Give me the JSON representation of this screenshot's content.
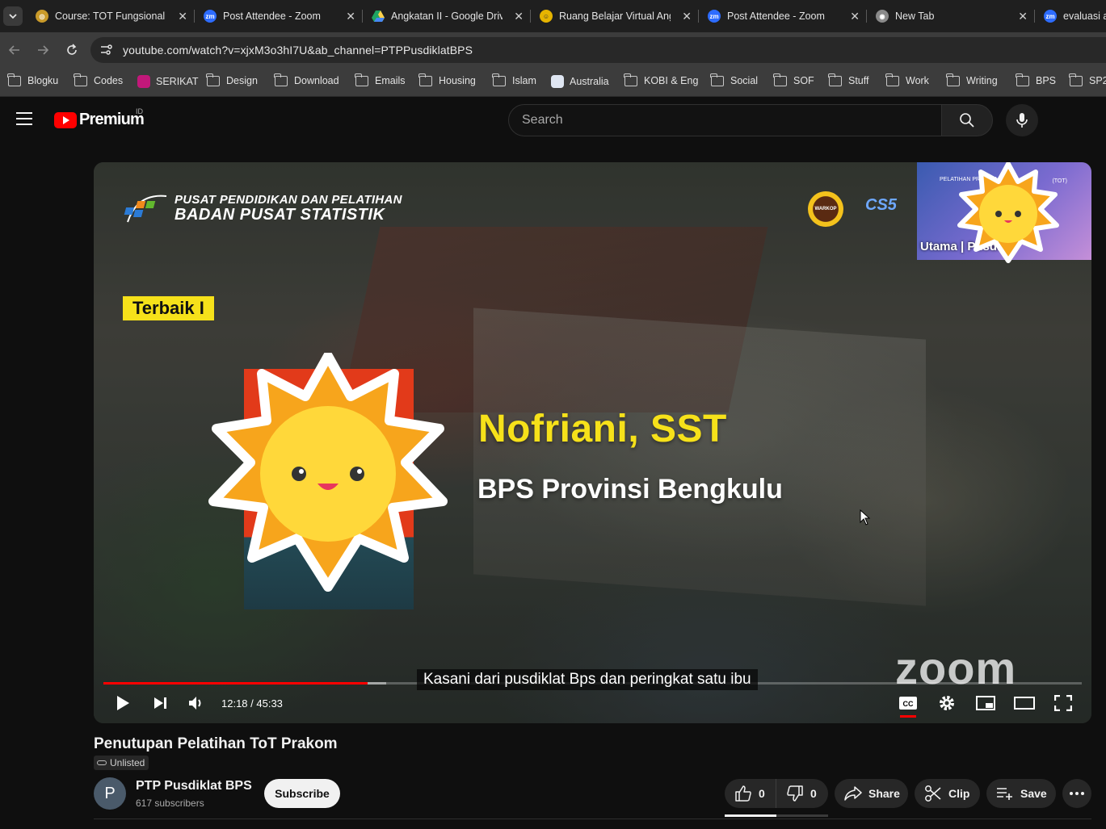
{
  "browser": {
    "tabs": [
      {
        "title": "Course: TOT Fungsional Prakom",
        "favicon": "moodle-icon"
      },
      {
        "title": "Post Attendee - Zoom",
        "favicon": "zoom-icon"
      },
      {
        "title": "Angkatan II - Google Drive",
        "favicon": "google-drive-icon"
      },
      {
        "title": "Ruang Belajar Virtual Angkatan",
        "favicon": "moodle-icon"
      },
      {
        "title": "Post Attendee - Zoom",
        "favicon": "zoom-icon"
      },
      {
        "title": "New Tab",
        "favicon": "chrome-icon"
      },
      {
        "title": "evaluasi ar",
        "favicon": "zoom-icon"
      }
    ],
    "url": "youtube.com/watch?v=xjxM3o3hI7U&ab_channel=PTPPusdiklatBPS",
    "bookmarks": [
      "Blogku",
      "Codes",
      "SERIKAT",
      "Design",
      "Download",
      "Emails",
      "Housing",
      "Islam",
      "Australia",
      "KOBI & Eng",
      "Social",
      "SOF",
      "Stuff",
      "Work",
      "Writing",
      "BPS",
      "SP2"
    ]
  },
  "youtube": {
    "logo_text": "Premium",
    "country_code": "ID",
    "search_placeholder": "Search"
  },
  "video": {
    "org_line1": "PUSAT PENDIDIKAN DAN PELATIHAN",
    "org_line2": "BADAN PUSAT STATISTIK",
    "warkop_logo_text": "WARKOP",
    "cs5_logo_text": "CS5",
    "pip_label": "Utama | Pusdi",
    "pip_top_text": "PELATIHAN PRAKOM",
    "pip_badge_text": "(TOT)",
    "badge": "Terbaik I",
    "name": "Nofriani, SST",
    "office": "BPS Provinsi Bengkulu",
    "watermark": "zoom",
    "caption": "Kasani dari pusdiklat Bps dan peringkat satu ibu",
    "timecode": "12:18 / 45:33",
    "played_fraction": 0.2701,
    "loaded_fraction": 0.2891,
    "cc_active": true
  },
  "info": {
    "title": "Penutupan Pelatihan ToT Prakom",
    "visibility": "Unlisted",
    "channel": "PTP Pusdiklat BPS",
    "channel_initial": "P",
    "subscribers": "617 subscribers",
    "subscribe_label": "Subscribe",
    "likes": "0",
    "dislikes": "0",
    "share_label": "Share",
    "clip_label": "Clip",
    "save_label": "Save"
  },
  "colors": {
    "accent_red": "#ff0000",
    "badge_yellow": "#f6e11a",
    "background": "#0f0f0f"
  }
}
